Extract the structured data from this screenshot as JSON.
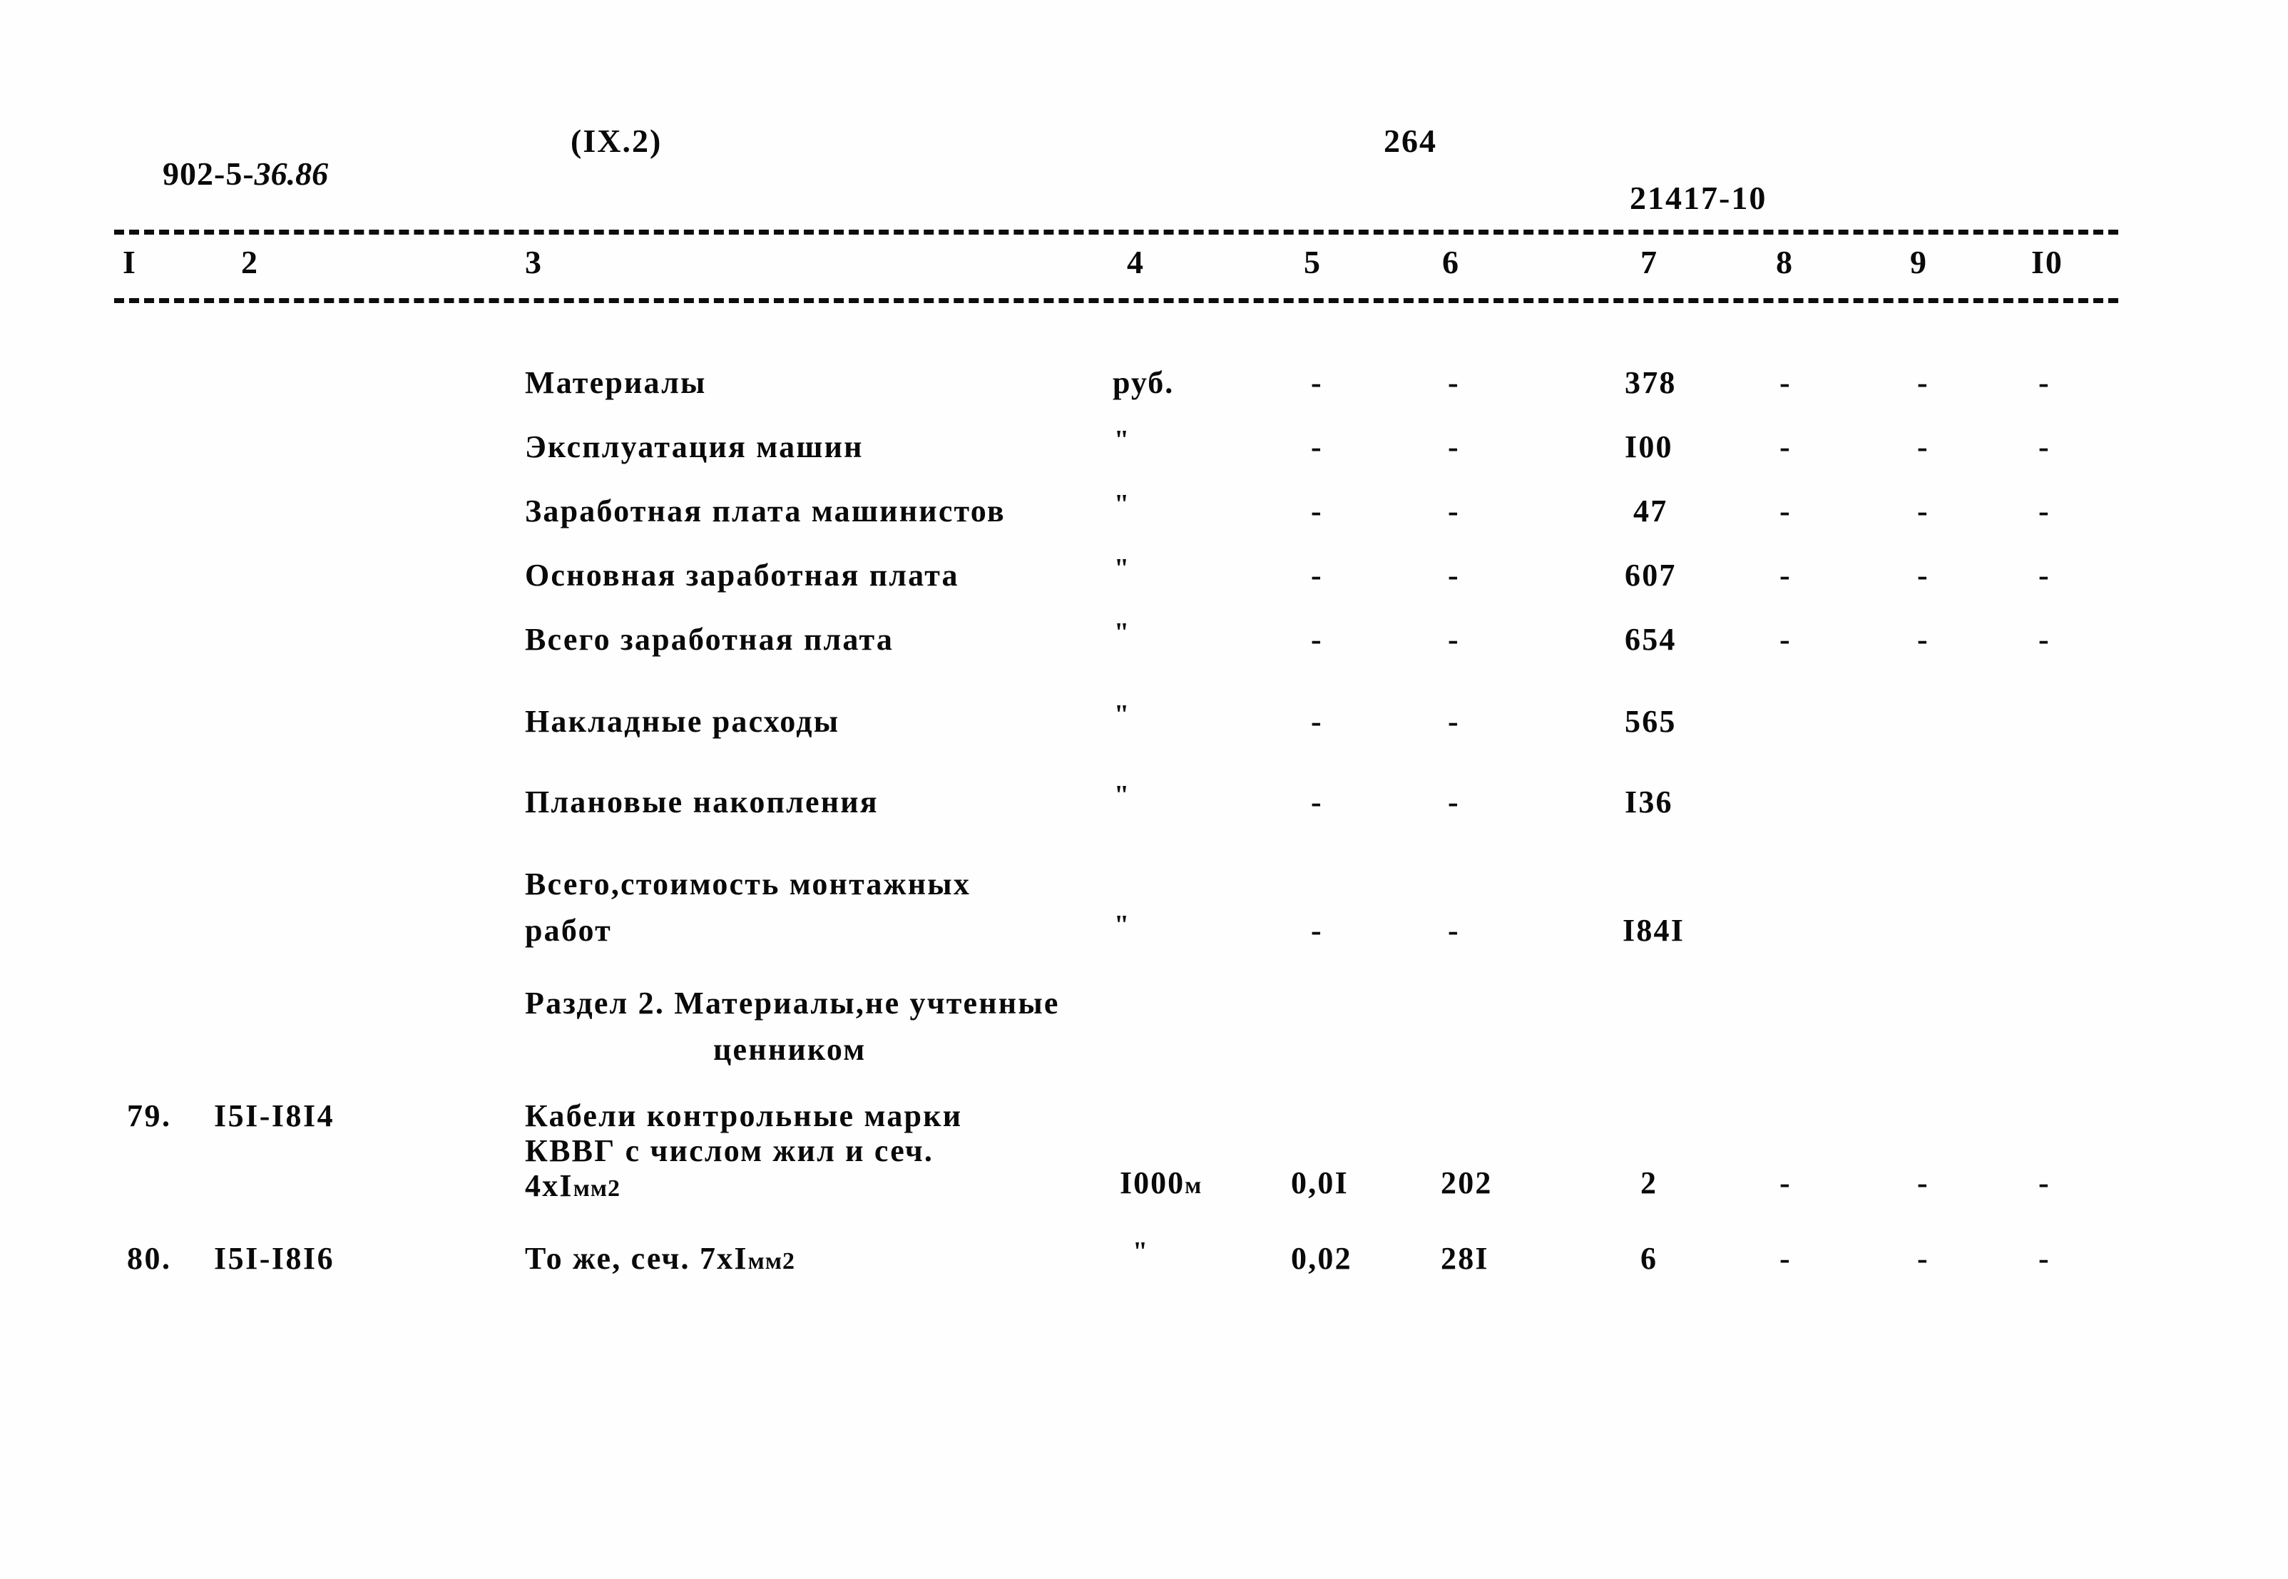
{
  "header": {
    "doc_code_prefix": "902-5-",
    "doc_code_hand": "36.86",
    "chapter_ref": "(IX.2)",
    "page_number": "264",
    "stamp_code": "21417-10"
  },
  "table": {
    "column_headers": [
      "I",
      "2",
      "3",
      "4",
      "5",
      "6",
      "7",
      "8",
      "9",
      "I0"
    ],
    "rows": [
      {
        "no": "",
        "code": "",
        "description": "Материалы",
        "unit": "руб.",
        "c5": "-",
        "c6": "-",
        "c7": "378",
        "c8": "-",
        "c9": "-",
        "c10": "-"
      },
      {
        "no": "",
        "code": "",
        "description": "Эксплуатация машин",
        "unit": "\"",
        "c5": "-",
        "c6": "-",
        "c7": "I00",
        "c8": "-",
        "c9": "-",
        "c10": "-"
      },
      {
        "no": "",
        "code": "",
        "description": "Заработная плата машинистов",
        "unit": "\"",
        "c5": "-",
        "c6": "-",
        "c7": "47",
        "c8": "-",
        "c9": "-",
        "c10": "-"
      },
      {
        "no": "",
        "code": "",
        "description": "Основная заработная плата",
        "unit": "\"",
        "c5": "-",
        "c6": "-",
        "c7": "607",
        "c8": "-",
        "c9": "-",
        "c10": "-"
      },
      {
        "no": "",
        "code": "",
        "description": "Всего заработная плата",
        "unit": "\"",
        "c5": "-",
        "c6": "-",
        "c7": "654",
        "c8": "-",
        "c9": "-",
        "c10": "-"
      },
      {
        "no": "",
        "code": "",
        "description": "Накладные расходы",
        "unit": "\"",
        "c5": "-",
        "c6": "-",
        "c7": "565",
        "c8": "",
        "c9": "",
        "c10": ""
      },
      {
        "no": "",
        "code": "",
        "description": "Плановые накопления",
        "unit": "\"",
        "c5": "-",
        "c6": "-",
        "c7": "I36",
        "c8": "",
        "c9": "",
        "c10": ""
      },
      {
        "no": "",
        "code": "",
        "description": "Всего,стоимость монтажных",
        "description_line2": "работ",
        "unit": "\"",
        "c5": "-",
        "c6": "-",
        "c7": "I84I",
        "c8": "",
        "c9": "",
        "c10": ""
      }
    ],
    "section_title_line1": "Раздел 2. Материалы,не учтенные",
    "section_title_line2": "ценником",
    "item_rows": [
      {
        "no": "79.",
        "code": "I5I-I8I4",
        "desc_l1": "Кабели контрольные марки",
        "desc_l2": "КВВГ с числом жил и сеч.",
        "desc_l3": "4xI",
        "desc_l3_sub": "мм2",
        "unit": "I000",
        "unit_sub": "м",
        "c5": "0,0I",
        "c6": "202",
        "c7": "2",
        "c8": "-",
        "c9": "-",
        "c10": "-"
      },
      {
        "no": "80.",
        "code": "I5I-I8I6",
        "desc_l1": "То же, сеч. 7xI",
        "desc_l1_sub": "мм2",
        "unit": "\"",
        "c5": "0,02",
        "c6": "28I",
        "c7": "6",
        "c8": "-",
        "c9": "-",
        "c10": "-"
      }
    ]
  },
  "colors": {
    "ink": "#0a0a0a",
    "paper": "#ffffff"
  }
}
